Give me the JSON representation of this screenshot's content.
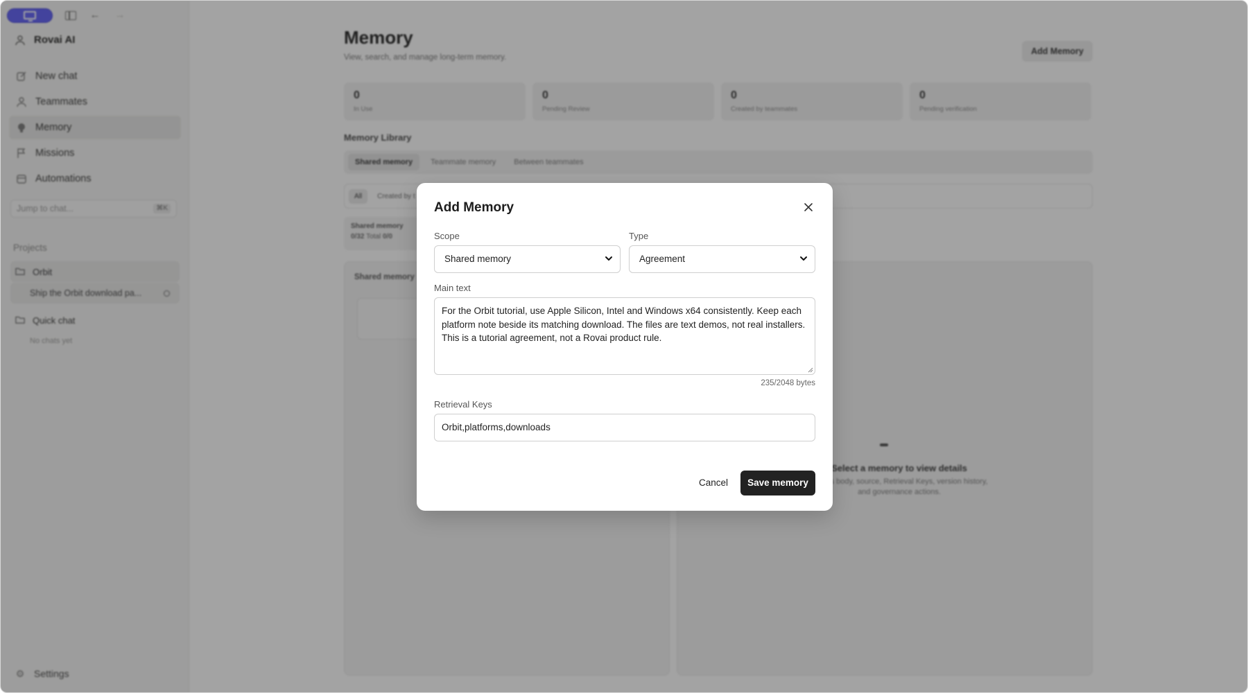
{
  "sidebar": {
    "brand": "Rovai AI",
    "nav": [
      {
        "label": "New chat",
        "icon": "edit-icon"
      },
      {
        "label": "Teammates",
        "icon": "user-icon"
      },
      {
        "label": "Memory",
        "icon": "memory-icon"
      },
      {
        "label": "Missions",
        "icon": "flag-icon"
      },
      {
        "label": "Automations",
        "icon": "calendar-icon"
      }
    ],
    "jump_placeholder": "Jump to chat...",
    "jump_shortcut": "⌘K",
    "projects_heading": "Projects",
    "projects": [
      {
        "label": "Orbit"
      },
      {
        "label": "Ship the Orbit download pa..."
      },
      {
        "label": "Quick chat"
      }
    ],
    "no_chats": "No chats yet",
    "settings_label": "Settings"
  },
  "main": {
    "title": "Memory",
    "subtitle": "View, search, and manage long-term memory.",
    "add_button": "Add Memory",
    "stats": [
      {
        "value": "0",
        "label": "In Use"
      },
      {
        "value": "0",
        "label": "Pending Review"
      },
      {
        "value": "0",
        "label": "Created by teammates"
      },
      {
        "value": "0",
        "label": "Pending verification"
      }
    ],
    "library_heading": "Memory Library",
    "tabs": [
      "Shared memory",
      "Teammate memory",
      "Between teammates"
    ],
    "filters": [
      "All",
      "Created by t"
    ],
    "summary": {
      "title": "Shared memory",
      "value_a": "0/32",
      "value_a_label": "Total",
      "value_b": "0/0"
    },
    "list_heading": "Shared memory",
    "empty_title": "Select a memory to view details",
    "empty_desc": "See its body, source, Retrieval Keys, version history, and governance actions."
  },
  "modal": {
    "title": "Add Memory",
    "scope_label": "Scope",
    "scope_value": "Shared memory",
    "type_label": "Type",
    "type_value": "Agreement",
    "main_text_label": "Main text",
    "main_text_value": "For the Orbit tutorial, use Apple Silicon, Intel and Windows x64 consistently. Keep each platform note beside its matching download. The files are text demos, not real installers. This is a tutorial agreement, not a Rovai product rule.",
    "byte_count": "235/2048 bytes",
    "keys_label": "Retrieval Keys",
    "keys_value": "Orbit,platforms,downloads",
    "cancel_label": "Cancel",
    "save_label": "Save memory"
  },
  "colors": {
    "accent_pill": "#5b5bf5",
    "primary_button": "#222222",
    "overlay": "rgba(35,35,35,0.42)"
  }
}
